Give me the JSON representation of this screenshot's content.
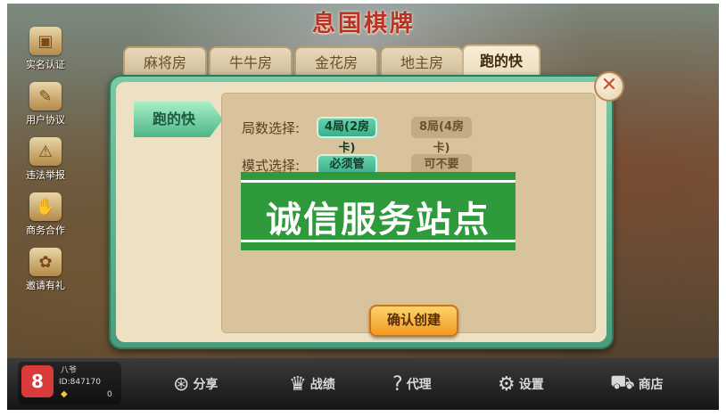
{
  "game": {
    "title": "息国棋牌"
  },
  "left_menu": [
    {
      "label": "实名认证",
      "icon": "id-card-icon"
    },
    {
      "label": "用户协议",
      "icon": "agreement-icon"
    },
    {
      "label": "违法举报",
      "icon": "report-icon"
    },
    {
      "label": "商务合作",
      "icon": "handshake-icon"
    },
    {
      "label": "邀请有礼",
      "icon": "gift-icon"
    }
  ],
  "tabs": [
    {
      "label": "麻将房",
      "active": false
    },
    {
      "label": "牛牛房",
      "active": false
    },
    {
      "label": "金花房",
      "active": false
    },
    {
      "label": "地主房",
      "active": false
    },
    {
      "label": "跑的快",
      "active": true
    }
  ],
  "dialog": {
    "side_tab": "跑的快",
    "rounds": {
      "label": "局数选择:",
      "options": [
        {
          "label": "4局(2房卡)",
          "selected": true
        },
        {
          "label": "8局(4房卡)",
          "selected": false
        }
      ]
    },
    "mode": {
      "label": "模式选择:",
      "options": [
        {
          "label": "必须管",
          "selected": true
        },
        {
          "label": "可不要",
          "selected": false
        }
      ]
    },
    "confirm_label": "确认创建",
    "close_icon": "close-icon"
  },
  "watermark": {
    "text": "诚信服务站点"
  },
  "user": {
    "name": "八爷",
    "id": "ID:847170",
    "gems": "0"
  },
  "bottom_nav": [
    {
      "label": "分享",
      "icon": "share-icon"
    },
    {
      "label": "战绩",
      "icon": "trophy-icon"
    },
    {
      "label": "代理",
      "icon": "question-icon"
    },
    {
      "label": "设置",
      "icon": "gear-icon"
    },
    {
      "label": "商店",
      "icon": "cart-icon"
    }
  ],
  "colors": {
    "accent_green": "#4eb588",
    "watermark_green": "#2f9a3b",
    "confirm_orange": "#f09a22"
  }
}
